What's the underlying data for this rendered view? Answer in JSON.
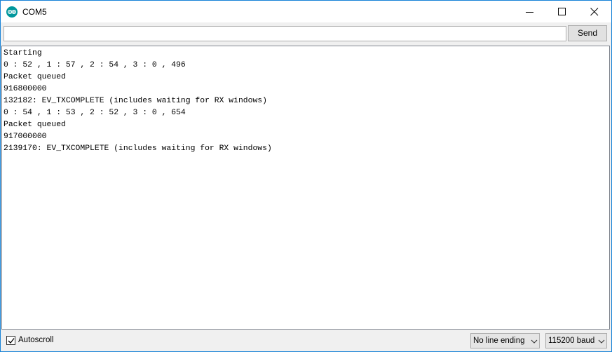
{
  "window": {
    "title": "COM5"
  },
  "toolbar": {
    "input_value": "",
    "send_label": "Send"
  },
  "output": {
    "lines": [
      "Starting",
      "0 : 52 , 1 : 57 , 2 : 54 , 3 : 0 , 496",
      "Packet queued",
      "916800000",
      "132182: EV_TXCOMPLETE (includes waiting for RX windows)",
      "0 : 54 , 1 : 53 , 2 : 52 , 3 : 0 , 654",
      "Packet queued",
      "917000000",
      "2139170: EV_TXCOMPLETE (includes waiting for RX windows)"
    ]
  },
  "footer": {
    "autoscroll_label": "Autoscroll",
    "autoscroll_checked": true,
    "line_ending_value": "No line ending",
    "baud_value": "115200 baud"
  },
  "icons": {
    "app": "arduino-icon",
    "minimize": "minimize-icon",
    "maximize": "maximize-icon",
    "close": "close-icon",
    "dropdown": "chevron-down-icon",
    "check": "checkmark-icon"
  },
  "colors": {
    "window_border": "#1883d7",
    "app_icon": "#00979c"
  }
}
